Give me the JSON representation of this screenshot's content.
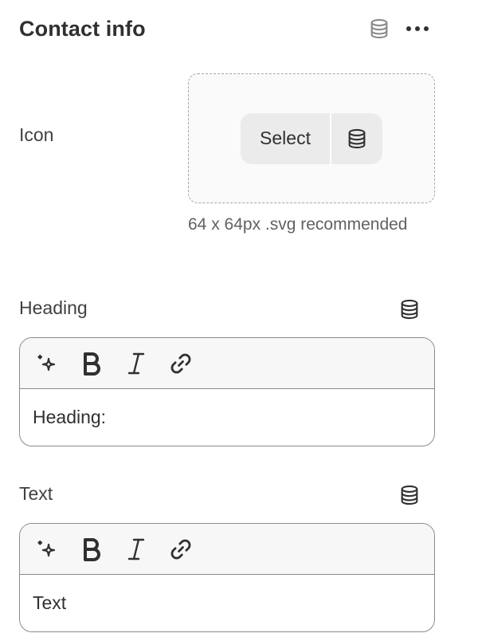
{
  "panel": {
    "title": "Contact info",
    "header_icons": [
      "database-icon",
      "more-horizontal-icon"
    ]
  },
  "icon_field": {
    "label": "Icon",
    "select_label": "Select",
    "select_icon": "database-icon",
    "hint": "64 x 64px .svg recommended"
  },
  "heading_field": {
    "label": "Heading",
    "value": "Heading:",
    "toolbar": [
      "magic-sparkle-icon",
      "bold-icon",
      "italic-icon",
      "link-icon"
    ]
  },
  "text_field": {
    "label": "Text",
    "value": "Text",
    "toolbar": [
      "magic-sparkle-icon",
      "bold-icon",
      "italic-icon",
      "link-icon"
    ]
  },
  "colors": {
    "text": "#303030",
    "muted": "#616161",
    "border": "#8a8a8a",
    "button_bg": "#ebebeb",
    "toolbar_bg": "#f7f7f7"
  }
}
